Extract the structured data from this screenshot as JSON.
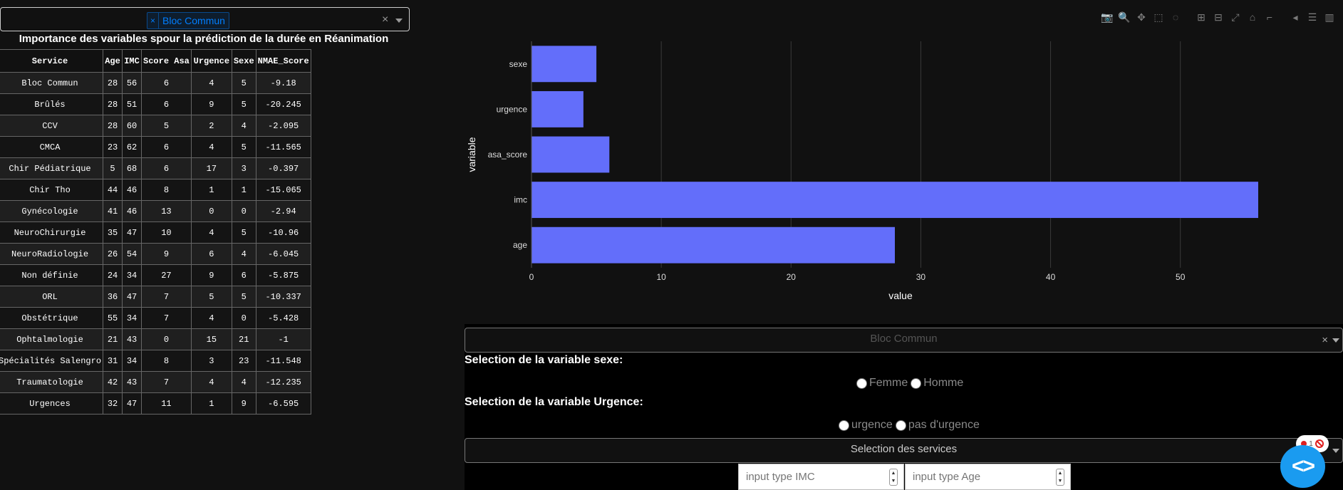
{
  "service_filter": {
    "selected_tag": "Bloc Commun",
    "clear_symbol": "×"
  },
  "table": {
    "title": "Importance des variables spour la prédiction de la durée en Réanimation",
    "columns": [
      "Service",
      "Age",
      "IMC",
      "Score Asa",
      "Urgence",
      "Sexe",
      "NMAE_Score"
    ],
    "rows": [
      [
        "Bloc Commun",
        "28",
        "56",
        "6",
        "4",
        "5",
        "-9.18"
      ],
      [
        "Brûlés",
        "28",
        "51",
        "6",
        "9",
        "5",
        "-20.245"
      ],
      [
        "CCV",
        "28",
        "60",
        "5",
        "2",
        "4",
        "-2.095"
      ],
      [
        "CMCA",
        "23",
        "62",
        "6",
        "4",
        "5",
        "-11.565"
      ],
      [
        "Chir Pédiatrique",
        "5",
        "68",
        "6",
        "17",
        "3",
        "-0.397"
      ],
      [
        "Chir Tho",
        "44",
        "46",
        "8",
        "1",
        "1",
        "-15.065"
      ],
      [
        "Gynécologie",
        "41",
        "46",
        "13",
        "0",
        "0",
        "-2.94"
      ],
      [
        "NeuroChirurgie",
        "35",
        "47",
        "10",
        "4",
        "5",
        "-10.96"
      ],
      [
        "NeuroRadiologie",
        "26",
        "54",
        "9",
        "6",
        "4",
        "-6.045"
      ],
      [
        "Non définie",
        "24",
        "34",
        "27",
        "9",
        "6",
        "-5.875"
      ],
      [
        "ORL",
        "36",
        "47",
        "7",
        "5",
        "5",
        "-10.337"
      ],
      [
        "Obstétrique",
        "55",
        "34",
        "7",
        "4",
        "0",
        "-5.428"
      ],
      [
        "Ophtalmologie",
        "21",
        "43",
        "0",
        "15",
        "21",
        "-1"
      ],
      [
        "Spécialités Salengro",
        "31",
        "34",
        "8",
        "3",
        "23",
        "-11.548"
      ],
      [
        "Traumatologie",
        "42",
        "43",
        "7",
        "4",
        "4",
        "-12.235"
      ],
      [
        "Urgences",
        "32",
        "47",
        "11",
        "1",
        "9",
        "-6.595"
      ]
    ]
  },
  "modebar": [
    "camera-icon",
    "zoom-icon",
    "pan-icon",
    "box-select-icon",
    "lasso-icon",
    "zoom-in-icon",
    "zoom-out-icon",
    "autoscale-icon",
    "reset-axes-icon",
    "spike-lines-icon",
    "hover-closest-icon",
    "hover-compare-icon",
    "plotly-logo-icon"
  ],
  "chart_data": {
    "type": "bar",
    "orientation": "horizontal",
    "categories": [
      "age",
      "imc",
      "asa_score",
      "urgence",
      "sexe"
    ],
    "values": [
      28,
      56,
      6,
      4,
      5
    ],
    "xlabel": "value",
    "ylabel": "variable",
    "xlim": [
      0,
      56
    ],
    "xticks": [
      "0",
      "10",
      "20",
      "30",
      "40",
      "50"
    ],
    "grid": true,
    "bar_color": "#636efa"
  },
  "controls": {
    "service_dropdown_placeholder": "Bloc Commun",
    "sexe_label": "Selection de la variable sexe:",
    "sexe_options": [
      "Femme",
      "Homme"
    ],
    "urgence_label": "Selection de la variable Urgence:",
    "urgence_options": [
      "urgence",
      "pas d'urgence"
    ],
    "services_placeholder": "Selection des services",
    "imc_placeholder": "input type IMC",
    "age_placeholder": "input type Age"
  },
  "devtools": {
    "error_count": "1"
  },
  "colors": {
    "bar": "#636efa",
    "tag": "#007eff",
    "dev_button": "#1a9bf0"
  }
}
